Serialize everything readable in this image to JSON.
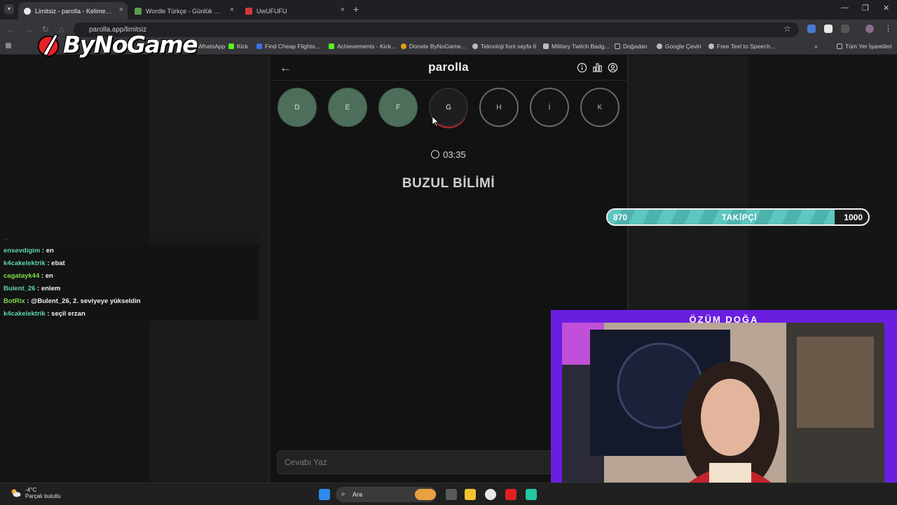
{
  "browser": {
    "tabs": [
      {
        "title": "Limitsiz - parolla - Kelime oyunu",
        "active": true,
        "favicon_color": "#e8e8e8"
      },
      {
        "title": "Wordle Türkçe - Günlük Kelime",
        "active": false,
        "favicon_color": "#5a9e4a"
      },
      {
        "title": "UwUFUFU",
        "active": false,
        "favicon_color": "#d9363e"
      }
    ],
    "url": "parolla.app/limitsiz",
    "bookmarks": [
      {
        "label": "WhatsApp",
        "icon_color": "#25d366"
      },
      {
        "label": "Kick",
        "icon_color": "#53fc18"
      },
      {
        "label": "Find Cheap Flights...",
        "icon_color": "#3b6ee8"
      },
      {
        "label": "Achievements - Kick...",
        "icon_color": "#53fc18"
      },
      {
        "label": "Donate ByNoGame...",
        "icon_color": "#e0a020"
      },
      {
        "label": "Teknoloji font sayfa 6",
        "icon_color": "#bbbbbb"
      },
      {
        "label": "Military Twitch Badg...",
        "icon_color": "#bbbbbb"
      },
      {
        "label": "Doğadan",
        "icon_color": "#bbbbbb"
      },
      {
        "label": "Google Çeviri",
        "icon_color": "#bbbbbb"
      },
      {
        "label": "Free Text to Speech...",
        "icon_color": "#bbbbbb"
      }
    ],
    "all_bookmarks": "Tüm Yer İşaretleri"
  },
  "overlay": {
    "logo_text": "ByNoGame"
  },
  "game": {
    "title": "parolla",
    "letters": [
      {
        "letter": "D",
        "state": "done"
      },
      {
        "letter": "E",
        "state": "done"
      },
      {
        "letter": "F",
        "state": "done"
      },
      {
        "letter": "G",
        "state": "current"
      },
      {
        "letter": "H",
        "state": "todo"
      },
      {
        "letter": "İ",
        "state": "todo"
      },
      {
        "letter": "K",
        "state": "todo"
      }
    ],
    "timer": "03:35",
    "question": "BUZUL BİLİMİ",
    "answer_placeholder": "Cevabı Yaz"
  },
  "chat": [
    {
      "user": "ensevdigim",
      "msg": "en",
      "color": "#5ed6a5"
    },
    {
      "user": "k4cakelektrik",
      "msg": "ebat",
      "color": "#5ed6a5"
    },
    {
      "user": "cagatayk44",
      "msg": "en",
      "color": "#7fdc4a"
    },
    {
      "user": "Bulent_26",
      "msg": "enlem",
      "color": "#5ed6a5"
    },
    {
      "user": "BotRix",
      "msg": "@Bulent_26, 2. seviyeye yükseldin",
      "color": "#7fdc4a"
    },
    {
      "user": "k4cakelektrik",
      "msg": "seçil erzan",
      "color": "#5ed6a5"
    }
  ],
  "follower_goal": {
    "current": "870",
    "label": "TAKİPÇİ",
    "target": "1000",
    "progress": 0.87
  },
  "webcam": {
    "name": "ÖZÜM DOĞA"
  },
  "taskbar": {
    "temperature": "-4°C",
    "weather": "Parçalı bulutlu",
    "search_placeholder": "Ara"
  }
}
